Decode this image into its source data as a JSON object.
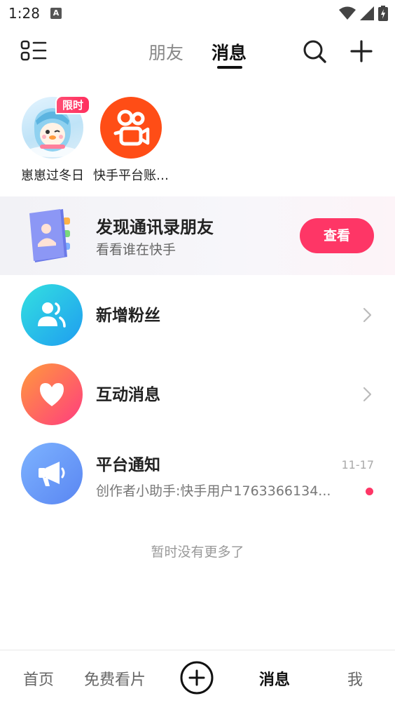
{
  "status_bar": {
    "time": "1:28",
    "notification_letter": "A"
  },
  "top_nav": {
    "tabs": [
      {
        "label": "朋友",
        "active": false
      },
      {
        "label": "消息",
        "active": true
      }
    ],
    "icons": [
      "list-menu-icon",
      "search-icon",
      "plus-icon"
    ]
  },
  "stories": [
    {
      "label": "崽崽过冬日",
      "badge": "限时",
      "avatar": "penguin-mascot"
    },
    {
      "label": "快手平台账…",
      "avatar": "kuaishou-logo"
    }
  ],
  "contacts_banner": {
    "title": "发现通讯录朋友",
    "subtitle": "看看谁在快手",
    "button_label": "查看"
  },
  "messages": [
    {
      "title": "新增粉丝",
      "icon": "followers-icon",
      "color": "#1fb8f0"
    },
    {
      "title": "互动消息",
      "icon": "heart-icon",
      "color": "#ff4d73"
    },
    {
      "title": "平台通知",
      "icon": "megaphone-icon",
      "time": "11-17",
      "preview": "创作者小助手:快手用户1763366134...",
      "unread": true,
      "color": "#5b8ef5"
    }
  ],
  "footer_text": "暂时没有更多了",
  "bottom_nav": {
    "items": [
      "首页",
      "免费看片",
      "消息",
      "我"
    ],
    "active": "消息",
    "create_icon": "plus-circle-icon"
  },
  "colors": {
    "accent": "#fe3666",
    "kuaishou_orange": "#ff4d16"
  }
}
